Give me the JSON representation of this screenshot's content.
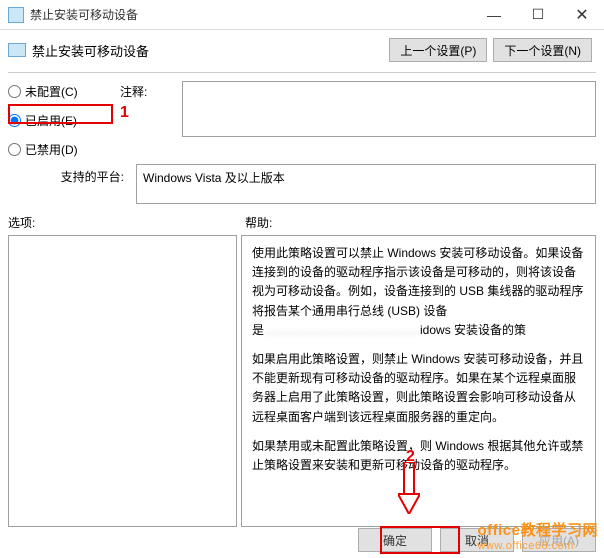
{
  "titlebar": {
    "title": "禁止安装可移动设备"
  },
  "header": {
    "title": "禁止安装可移动设备",
    "prev": "上一个设置(P)",
    "next": "下一个设置(N)"
  },
  "radios": {
    "notConfigured": "未配置(C)",
    "enabled": "已启用(E)",
    "disabled": "已禁用(D)"
  },
  "comment": {
    "label": "注释:",
    "value": ""
  },
  "platform": {
    "label": "支持的平台:",
    "value": "Windows Vista 及以上版本"
  },
  "labels": {
    "options": "选项:",
    "help": "帮助:"
  },
  "help": {
    "p1": "使用此策略设置可以禁止 Windows 安装可移动设备。如果设备连接到的设备的驱动程序指示该设备是可移动的，则将该设备视为可移动设备。例如，设备连接到的 USB 集线器的驱动程序将报告某个通用串行总线 (USB) 设备是",
    "p1_blur": "…………………………………",
    "p1_tail": "idows 安装设备的策",
    "p2": "如果启用此策略设置，则禁止 Windows 安装可移动设备，并且不能更新现有可移动设备的驱动程序。如果在某个远程桌面服务器上启用了此策略设置，则此策略设置会影响可移动设备从远程桌面客户端到该远程桌面服务器的重定向。",
    "p3": "如果禁用或未配置此策略设置，则 Windows 根据其他允许或禁止策略设置来安装和更新可移动设备的驱动程序。"
  },
  "footer": {
    "ok": "确定",
    "cancel": "取消",
    "apply": "应用(A)"
  },
  "annotations": {
    "one": "1",
    "two": "2"
  },
  "watermark": {
    "main": "office教程学习网",
    "sub": "www.office68.com"
  }
}
